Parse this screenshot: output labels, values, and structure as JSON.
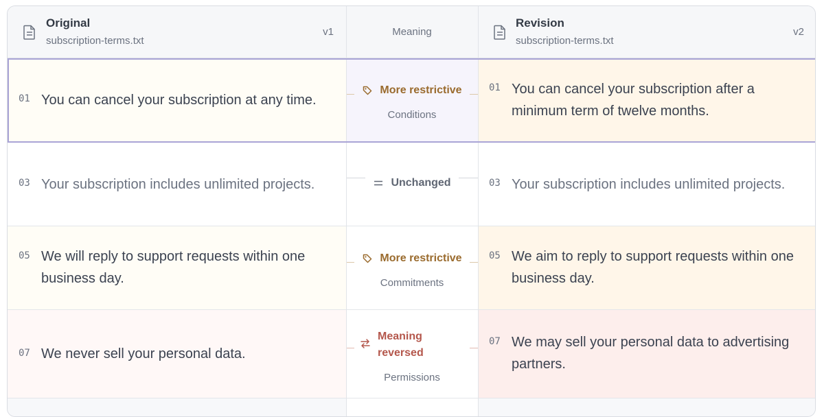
{
  "header": {
    "original": {
      "title": "Original",
      "file": "subscription-terms.txt",
      "version": "v1"
    },
    "meaning": "Meaning",
    "revision": {
      "title": "Revision",
      "file": "subscription-terms.txt",
      "version": "v2"
    }
  },
  "rows": [
    {
      "left_line": "01",
      "left_text": "You can cancel your subscription at any time.",
      "right_line": "01",
      "right_text": "You can cancel your subscription after a minimum term of twelve months.",
      "change": "More restrictive",
      "category": "Conditions",
      "icon": "tag-icon",
      "selected": true
    },
    {
      "left_line": "03",
      "left_text": "Your subscription includes unlimited projects.",
      "right_line": "03",
      "right_text": "Your subscription includes unlimited projects.",
      "change": "Unchanged",
      "category": "",
      "icon": "equals-icon"
    },
    {
      "left_line": "05",
      "left_text": "We will reply to support requests within one business day.",
      "right_line": "05",
      "right_text": "We aim to reply to support requests within one business day.",
      "change": "More restrictive",
      "category": "Commitments",
      "icon": "tag-icon"
    },
    {
      "left_line": "07",
      "left_text": "We never sell your personal data.",
      "right_line": "07",
      "right_text": "We may sell your personal data to advertising partners.",
      "change": "Meaning reversed",
      "category": "Permissions",
      "icon": "swap-arrows-icon"
    }
  ],
  "colors": {
    "restrictive": "#9a6b2e",
    "unchanged": "#5f6673",
    "reversed": "#b4574c",
    "selection": "#a9a4d6"
  }
}
